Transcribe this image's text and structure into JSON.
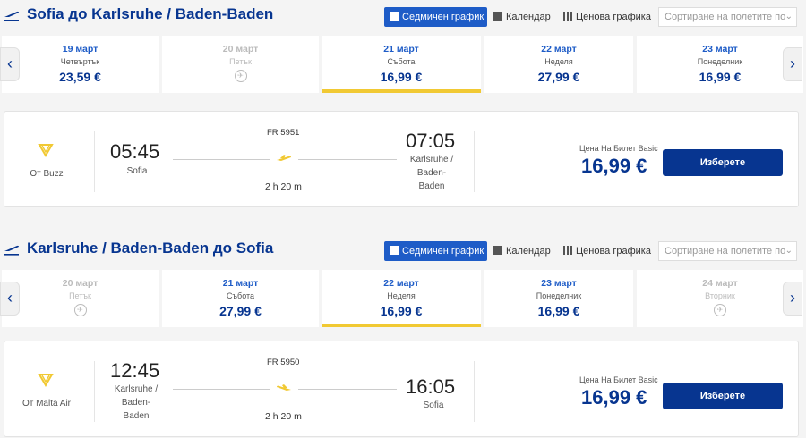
{
  "colors": {
    "brand_blue": "#073590",
    "accent_blue": "#1e5cc7",
    "accent_yellow": "#f1c933"
  },
  "sections": [
    {
      "title": "Sofia до Karlsruhe / Baden-Baden",
      "view_weekly": "Седмичен график",
      "view_calendar": "Календар",
      "view_price_graph": "Ценова графика",
      "sort_placeholder": "Сортиране на полетите по",
      "days": [
        {
          "date": "19 март",
          "dow": "Четвъртък",
          "price": "23,59 €"
        },
        {
          "date": "20 март",
          "dow": "Петък",
          "price": null,
          "icon": "no-flight-icon"
        },
        {
          "date": "21 март",
          "dow": "Събота",
          "price": "16,99 €",
          "selected": true
        },
        {
          "date": "22 март",
          "dow": "Неделя",
          "price": "27,99 €"
        },
        {
          "date": "23 март",
          "dow": "Понеделник",
          "price": "16,99 €"
        }
      ],
      "flight": {
        "operator": "От Buzz",
        "flight_no": "FR 5951",
        "depart_time": "05:45",
        "depart_city": "Sofia",
        "arrive_time": "07:05",
        "arrive_city_lines": [
          "Karlsruhe /",
          "Baden-",
          "Baden"
        ],
        "duration": "2 h 20 m",
        "fare_label": "Цена На Билет Basic",
        "fare_price": "16,99 €",
        "select_label": "Изберете"
      }
    },
    {
      "title": "Karlsruhe / Baden-Baden до Sofia",
      "view_weekly": "Седмичен график",
      "view_calendar": "Календар",
      "view_price_graph": "Ценова графика",
      "sort_placeholder": "Сортиране на полетите по",
      "days": [
        {
          "date": "20 март",
          "dow": "Петък",
          "price": null,
          "icon": "no-flight-icon"
        },
        {
          "date": "21 март",
          "dow": "Събота",
          "price": "27,99 €"
        },
        {
          "date": "22 март",
          "dow": "Неделя",
          "price": "16,99 €",
          "selected": true
        },
        {
          "date": "23 март",
          "dow": "Понеделник",
          "price": "16,99 €"
        },
        {
          "date": "24 март",
          "dow": "Вторник",
          "price": null,
          "icon": "no-flight-icon"
        }
      ],
      "flight": {
        "operator": "От Malta Air",
        "flight_no": "FR 5950",
        "depart_time": "12:45",
        "depart_city_lines": [
          "Karlsruhe /",
          "Baden-",
          "Baden"
        ],
        "arrive_time": "16:05",
        "arrive_city": "Sofia",
        "duration": "2 h 20 m",
        "fare_label": "Цена На Билет Basic",
        "fare_price": "16,99 €",
        "select_label": "Изберете"
      }
    }
  ]
}
